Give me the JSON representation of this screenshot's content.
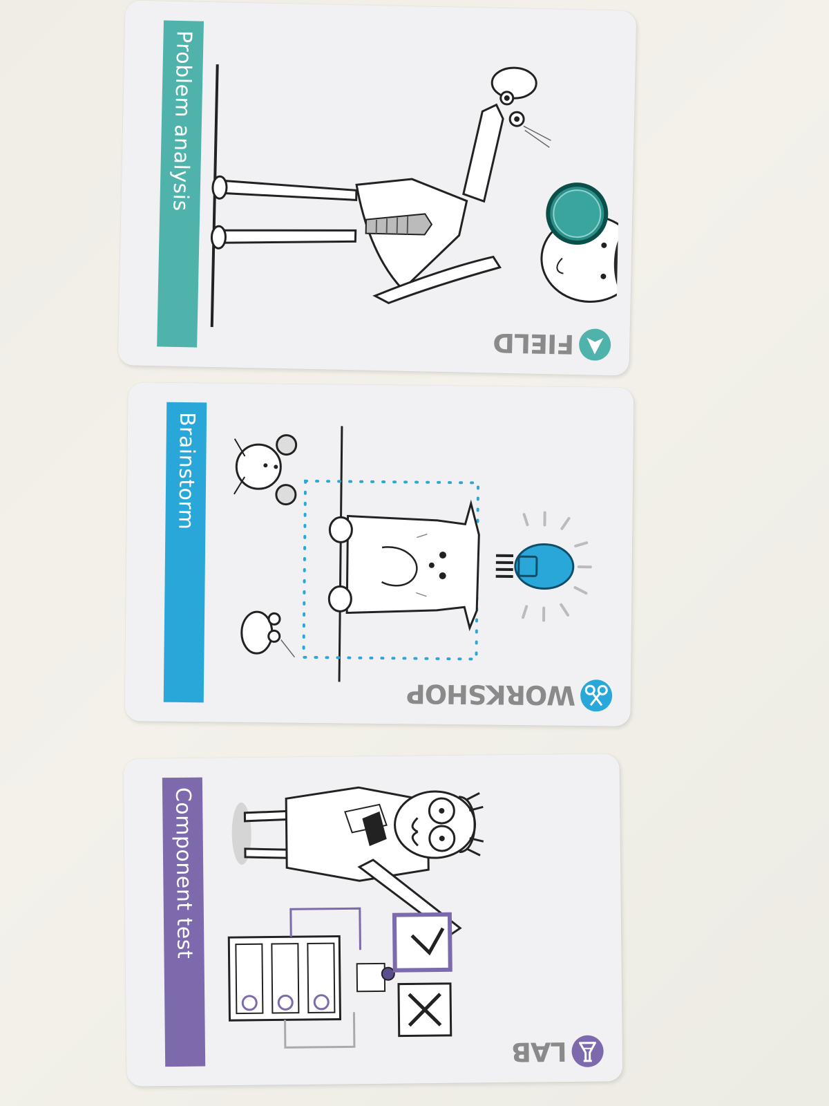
{
  "cards": [
    {
      "title": "Problem analysis",
      "category": "FIELD",
      "accent": "#4fb3ac",
      "icon": "arrow-up-icon"
    },
    {
      "title": "Brainstorm",
      "category": "WORKSHOP",
      "accent": "#2aa7d9",
      "icon": "scissors-icon"
    },
    {
      "title": "Component test",
      "category": "LAB",
      "accent": "#7c6aad",
      "icon": "flask-icon"
    }
  ]
}
